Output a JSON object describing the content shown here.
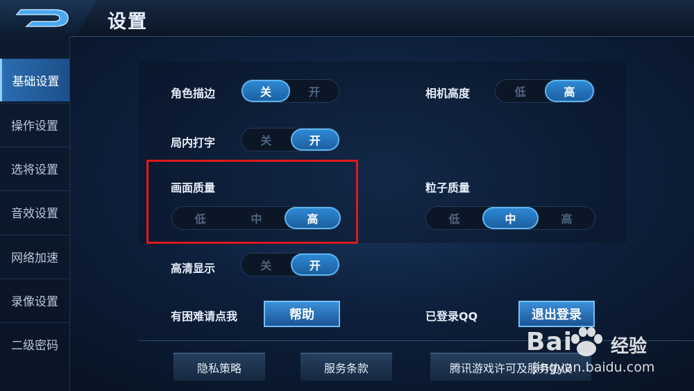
{
  "header": {
    "title": "设置",
    "logo_icon": "d-logo-icon"
  },
  "sidebar": {
    "items": [
      {
        "label": "基础设置",
        "active": true
      },
      {
        "label": "操作设置"
      },
      {
        "label": "选将设置"
      },
      {
        "label": "音效设置"
      },
      {
        "label": "网络加速"
      },
      {
        "label": "录像设置"
      },
      {
        "label": "二级密码"
      }
    ]
  },
  "settings": {
    "outline": {
      "label": "角色描边",
      "options": [
        "关",
        "开"
      ],
      "selected": "关"
    },
    "camera": {
      "label": "相机高度",
      "options": [
        "低",
        "高"
      ],
      "selected": "高"
    },
    "chat": {
      "label": "局内打字",
      "options": [
        "关",
        "开"
      ],
      "selected": "开"
    },
    "quality": {
      "label": "画面质量",
      "options": [
        "低",
        "中",
        "高"
      ],
      "selected": "高"
    },
    "particle": {
      "label": "粒子质量",
      "options": [
        "低",
        "中",
        "高"
      ],
      "selected": "中"
    },
    "hd": {
      "label": "高清显示",
      "options": [
        "关",
        "开"
      ],
      "selected": "开"
    },
    "help": {
      "label": "有困难请点我",
      "button": "帮助"
    },
    "account": {
      "label": "已登录QQ",
      "button": "退出登录"
    }
  },
  "footer": {
    "privacy": "隐私策略",
    "terms": "服务条款",
    "license": "腾讯游戏许可及服务协议"
  },
  "watermark": {
    "brand": "Bai",
    "brand2": "经验",
    "url": "jingyan.baidu.com"
  },
  "colors": {
    "accent": "#2f8ad6",
    "highlight": "#e0191b"
  }
}
